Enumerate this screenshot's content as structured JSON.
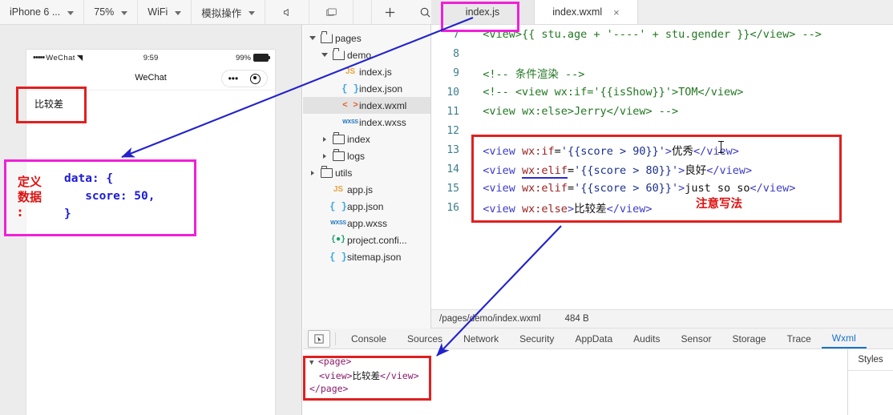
{
  "toolbar": {
    "device": "iPhone 6 ...",
    "zoom": "75%",
    "network": "WiFi",
    "simulate": "模拟操作",
    "icons": {
      "volume": "volume-icon",
      "screen": "screen-icon",
      "add": "plus-icon",
      "search": "search-icon",
      "more": "more-icon",
      "details": "details-icon"
    }
  },
  "simulator": {
    "status_bar": {
      "carrier": "WeChat",
      "signal_dots": "•••••",
      "wifi": "◥",
      "time": "9:59",
      "battery": "99%"
    },
    "nav_title": "WeChat",
    "page_text": "比较差"
  },
  "file_tree": [
    {
      "label": "pages",
      "type": "folder",
      "depth": 0,
      "expanded": true,
      "selected": false
    },
    {
      "label": "demo",
      "type": "folder",
      "depth": 1,
      "expanded": true,
      "selected": false
    },
    {
      "label": "index.js",
      "type": "js",
      "depth": 2,
      "selected": false
    },
    {
      "label": "index.json",
      "type": "json",
      "depth": 2,
      "selected": false
    },
    {
      "label": "index.wxml",
      "type": "wxml",
      "depth": 2,
      "selected": true
    },
    {
      "label": "index.wxss",
      "type": "wxss",
      "depth": 2,
      "selected": false
    },
    {
      "label": "index",
      "type": "folder",
      "depth": 1,
      "expanded": false,
      "selected": false
    },
    {
      "label": "logs",
      "type": "folder",
      "depth": 1,
      "expanded": false,
      "selected": false
    },
    {
      "label": "utils",
      "type": "folder",
      "depth": 0,
      "expanded": false,
      "selected": false
    },
    {
      "label": "app.js",
      "type": "js",
      "depth": 1,
      "selected": false
    },
    {
      "label": "app.json",
      "type": "json",
      "depth": 1,
      "selected": false
    },
    {
      "label": "app.wxss",
      "type": "wxss",
      "depth": 1,
      "selected": false
    },
    {
      "label": "project.confi...",
      "type": "cfg",
      "depth": 1,
      "selected": false
    },
    {
      "label": "sitemap.json",
      "type": "json",
      "depth": 1,
      "selected": false
    }
  ],
  "editor": {
    "tabs": [
      {
        "label": "index.js",
        "active": false,
        "closable": false
      },
      {
        "label": "index.wxml",
        "active": true,
        "closable": true,
        "close": "×"
      }
    ],
    "lines": [
      {
        "n": "7",
        "segs": [
          {
            "t": "  <view>{{ stu.age + '----' + stu.gender }}</view> -->",
            "c": "cm"
          }
        ]
      },
      {
        "n": "8",
        "segs": [
          {
            "t": "",
            "c": "cm"
          }
        ]
      },
      {
        "n": "9",
        "segs": [
          {
            "t": "  <!-- 条件渲染 -->",
            "c": "cm"
          }
        ]
      },
      {
        "n": "10",
        "segs": [
          {
            "t": "  <!-- <view wx:if='{{isShow}}'>TOM</view>",
            "c": "cm"
          }
        ]
      },
      {
        "n": "11",
        "segs": [
          {
            "t": "  <view wx:else>Jerry</view> -->",
            "c": "cm"
          }
        ]
      },
      {
        "n": "12",
        "segs": [
          {
            "t": "",
            "c": "cm"
          }
        ]
      },
      {
        "n": "13",
        "segs": [
          {
            "t": "  <view ",
            "c": "tag"
          },
          {
            "t": "wx:if",
            "c": "attr"
          },
          {
            "t": "=",
            "c": "txt"
          },
          {
            "t": "'{{score > 90}}'",
            "c": "str"
          },
          {
            "t": ">",
            "c": "tag"
          },
          {
            "t": "优秀",
            "c": "txt"
          },
          {
            "t": "</view>",
            "c": "tag"
          }
        ]
      },
      {
        "n": "14",
        "segs": [
          {
            "t": "  <view ",
            "c": "tag"
          },
          {
            "t": "wx:elif",
            "c": "attr under"
          },
          {
            "t": "=",
            "c": "txt"
          },
          {
            "t": "'{{score > 80}}'",
            "c": "str"
          },
          {
            "t": ">",
            "c": "tag"
          },
          {
            "t": "良好",
            "c": "txt"
          },
          {
            "t": "</view>",
            "c": "tag"
          }
        ]
      },
      {
        "n": "15",
        "segs": [
          {
            "t": "  <view ",
            "c": "tag"
          },
          {
            "t": "wx:elif",
            "c": "attr"
          },
          {
            "t": "=",
            "c": "txt"
          },
          {
            "t": "'{{score > 60}}'",
            "c": "str"
          },
          {
            "t": ">",
            "c": "tag"
          },
          {
            "t": "just so so",
            "c": "txt"
          },
          {
            "t": "</view>",
            "c": "tag"
          }
        ]
      },
      {
        "n": "16",
        "segs": [
          {
            "t": "  <view ",
            "c": "tag"
          },
          {
            "t": "wx:else",
            "c": "attr"
          },
          {
            "t": ">",
            "c": "tag"
          },
          {
            "t": "比较差",
            "c": "txt"
          },
          {
            "t": "</view>",
            "c": "tag"
          }
        ]
      }
    ]
  },
  "file_info": {
    "path": "/pages/demo/index.wxml",
    "size": "484 B"
  },
  "devtools": {
    "inspect_icon": "inspect-cursor-icon",
    "tabs": [
      {
        "label": "Console",
        "active": false
      },
      {
        "label": "Sources",
        "active": false
      },
      {
        "label": "Network",
        "active": false
      },
      {
        "label": "Security",
        "active": false
      },
      {
        "label": "AppData",
        "active": false
      },
      {
        "label": "Audits",
        "active": false
      },
      {
        "label": "Sensor",
        "active": false
      },
      {
        "label": "Storage",
        "active": false
      },
      {
        "label": "Trace",
        "active": false
      },
      {
        "label": "Wxml",
        "active": true
      }
    ],
    "wxml_tree": [
      {
        "indent": 0,
        "arrow": "▼",
        "segs": [
          {
            "t": "<page>",
            "c": "dtag"
          }
        ]
      },
      {
        "indent": 1,
        "arrow": "",
        "segs": [
          {
            "t": "<view>",
            "c": "dtag"
          },
          {
            "t": "比较差",
            "c": "txt"
          },
          {
            "t": "</view>",
            "c": "dtag"
          }
        ]
      },
      {
        "indent": 0,
        "arrow": "",
        "segs": [
          {
            "t": "</page>",
            "c": "dtag"
          }
        ]
      }
    ],
    "styles_tab": "Styles"
  },
  "annotations": {
    "data_label": "定义\n数据\n:",
    "data_code": "data: {\n   score: 50,\n}",
    "code_note": "注意写法",
    "colors": {
      "red_box": "#e02020",
      "magenta_box": "#f020d8",
      "arrow_blue": "#2222cc"
    }
  }
}
